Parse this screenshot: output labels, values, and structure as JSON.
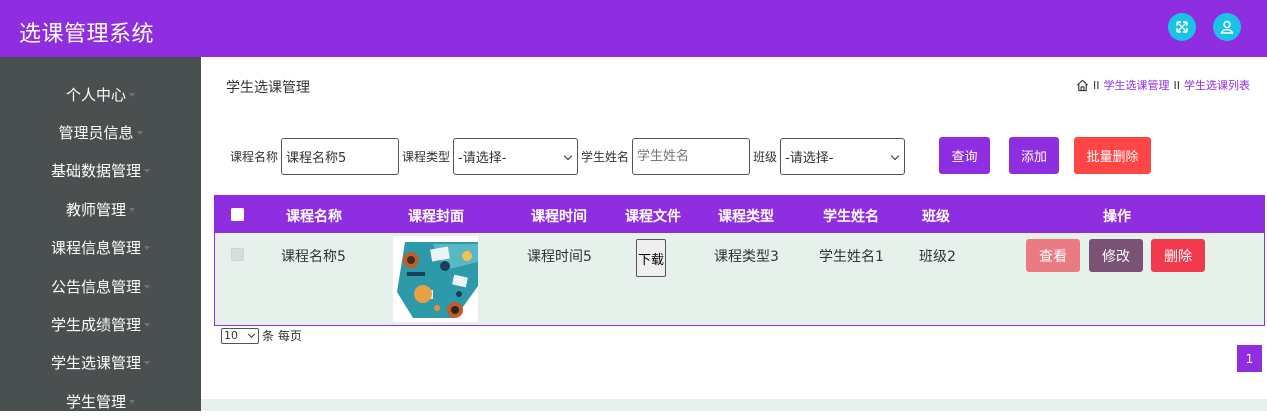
{
  "app": {
    "title": "选课管理系统"
  },
  "header_icons": [
    "fullscreen-icon",
    "user-icon"
  ],
  "sidebar": {
    "items": [
      {
        "label": "个人中心"
      },
      {
        "label": "管理员信息"
      },
      {
        "label": "基础数据管理"
      },
      {
        "label": "教师管理"
      },
      {
        "label": "课程信息管理"
      },
      {
        "label": "公告信息管理"
      },
      {
        "label": "学生成绩管理"
      },
      {
        "label": "学生选课管理"
      },
      {
        "label": "学生管理"
      }
    ]
  },
  "page": {
    "title": "学生选课管理",
    "breadcrumb": {
      "sep": "II",
      "items": [
        "学生选课管理",
        "学生选课列表"
      ]
    }
  },
  "search": {
    "course_name_label": "课程名称",
    "course_name_value": "课程名称5",
    "course_type_label": "课程类型",
    "course_type_value": "-请选择-",
    "student_name_label": "学生姓名",
    "student_name_placeholder": "学生姓名",
    "class_label": "班级",
    "class_value": "-请选择-",
    "query_button": "查询",
    "add_button": "添加",
    "batch_delete_button": "批量删除"
  },
  "table": {
    "headers": [
      "课程名称",
      "课程封面",
      "课程时间",
      "课程文件",
      "课程类型",
      "学生姓名",
      "班级",
      "操作"
    ],
    "rows": [
      {
        "course_name": "课程名称5",
        "course_time": "课程时间5",
        "file_button": "下载",
        "course_type": "课程类型3",
        "student_name": "学生姓名1",
        "class": "班级2",
        "view_button": "查看",
        "edit_button": "修改",
        "delete_button": "删除"
      }
    ]
  },
  "pagination": {
    "page_size": "10",
    "page_size_suffix": "条 每页",
    "current_page": "1"
  },
  "colors": {
    "primary": "#8f2ee0",
    "sidebar": "#4a4f50",
    "header_icon": "#19c3e6",
    "view": "#ea7b82",
    "edit": "#7a5276",
    "delete": "#f23a4f",
    "batch_delete": "#ff4646",
    "row_bg": "#e6f1ec"
  }
}
